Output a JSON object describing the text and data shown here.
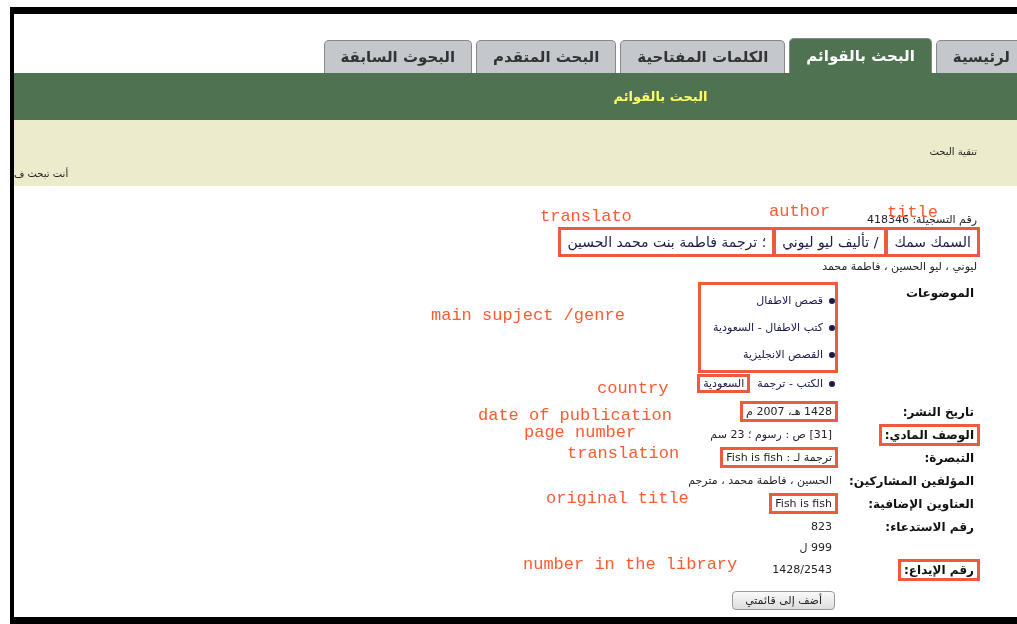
{
  "tabs": [
    {
      "label": "لرئيسية",
      "selected": false
    },
    {
      "label": "البحث بالقوائم",
      "selected": true
    },
    {
      "label": "الكلمات المفتاحية",
      "selected": false
    },
    {
      "label": "البحث المتقدم",
      "selected": false
    },
    {
      "label": "البحوث السابقة",
      "selected": false
    }
  ],
  "banner": {
    "title": "البحث بالقوائم"
  },
  "refine_link": "تنقية البحث",
  "search_context": "أنت تبحث ف",
  "record": {
    "record_number": "رقم التسجيلة: 418346",
    "title_parts": [
      {
        "text": "السمك سمك",
        "annotated": true
      },
      {
        "text": "/ تأليف ليو ليوني",
        "annotated": true
      },
      {
        "text": "؛ ترجمة فاطمة بنت محمد الحسين",
        "annotated": true
      }
    ],
    "authors": "ليوني ، ليو الحسين ، فاطمة محمد",
    "subjects": {
      "label": "الموضوعات",
      "items": [
        {
          "text": "قصص الاطفال",
          "annotated": true
        },
        {
          "text": "كتب الاطفال - السعودية",
          "annotated": true
        },
        {
          "text": "القصص الانجليزية",
          "annotated": true
        },
        {
          "text": "الكتب - ترجمة",
          "place": "السعودية",
          "annotated": false,
          "place_annotated": true
        }
      ]
    },
    "fields": [
      {
        "label": "تاريخ النشر:",
        "values": [
          "1428 هـ، 2007 م"
        ],
        "label_annotated": false,
        "value_annotated": true
      },
      {
        "label": "الوصف المادي:",
        "values": [
          "[31] ص : رسوم ؛ 23 سم"
        ],
        "label_annotated": true,
        "value_annotated": false
      },
      {
        "label": "التبصرة:",
        "values": [
          "ترجمة لـ : Fish is fish"
        ],
        "label_annotated": false,
        "value_annotated": true
      },
      {
        "label": "المؤلفين المشاركين:",
        "values": [
          "الحسين ، فاطمة محمد ، مترجم"
        ],
        "label_annotated": false,
        "value_annotated": false
      },
      {
        "label": "العناوين الإضافية:",
        "values": [
          "Fish is fish"
        ],
        "label_annotated": false,
        "value_annotated": true
      },
      {
        "label": "رقم الاستدعاء:",
        "values": [
          "823",
          "999 ل"
        ],
        "label_annotated": false,
        "value_annotated": false
      },
      {
        "label": "رقم الإيداع:",
        "values": [
          "1428/2543"
        ],
        "label_annotated": true,
        "value_annotated": false
      }
    ],
    "button": "أضف إلى قائمتي"
  },
  "annotations": [
    {
      "text": "title"
    },
    {
      "text": "author"
    },
    {
      "text": "translato"
    },
    {
      "text": "main supject /genre"
    },
    {
      "text": "country"
    },
    {
      "text": "date of publication"
    },
    {
      "text": "page number"
    },
    {
      "text": "translation"
    },
    {
      "text": "original title"
    },
    {
      "text": "number in the library"
    }
  ]
}
